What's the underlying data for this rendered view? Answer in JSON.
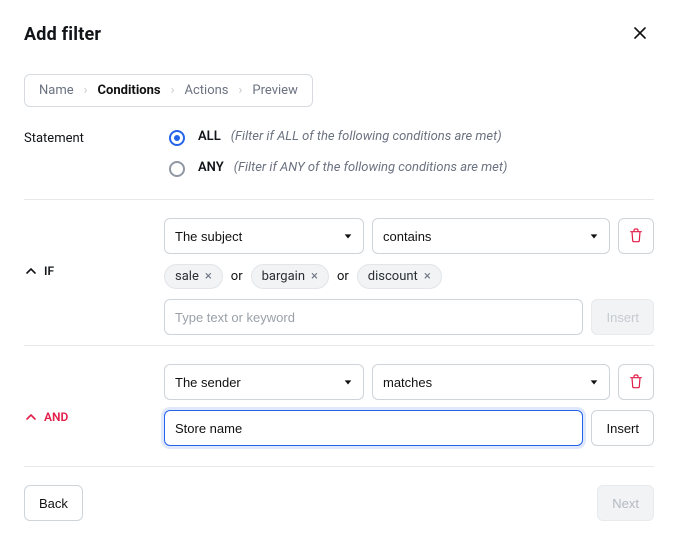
{
  "header": {
    "title": "Add filter"
  },
  "steps": {
    "items": [
      {
        "label": "Name"
      },
      {
        "label": "Conditions",
        "active": true
      },
      {
        "label": "Actions"
      },
      {
        "label": "Preview"
      }
    ],
    "sep": "›"
  },
  "statement": {
    "label": "Statement",
    "options": {
      "all": {
        "code": "ALL",
        "desc": "(Filter if ALL of the following conditions are met)"
      },
      "any": {
        "code": "ANY",
        "desc": "(Filter if ANY of the following conditions are met)"
      }
    },
    "value": "ALL"
  },
  "conditions": [
    {
      "connector": "IF",
      "field": "The subject",
      "operator": "contains",
      "tags": [
        "sale",
        "bargain",
        "discount"
      ],
      "or_label": "or",
      "input_value": "",
      "input_placeholder": "Type text or keyword",
      "insert_label": "Insert",
      "insert_disabled": true
    },
    {
      "connector": "AND",
      "field": "The sender",
      "operator": "matches",
      "input_value": "Store name",
      "input_focused": true,
      "insert_label": "Insert",
      "insert_disabled": false
    }
  ],
  "footer": {
    "back": "Back",
    "next": "Next",
    "next_disabled": true
  },
  "icons": {
    "chip_x": "×"
  }
}
